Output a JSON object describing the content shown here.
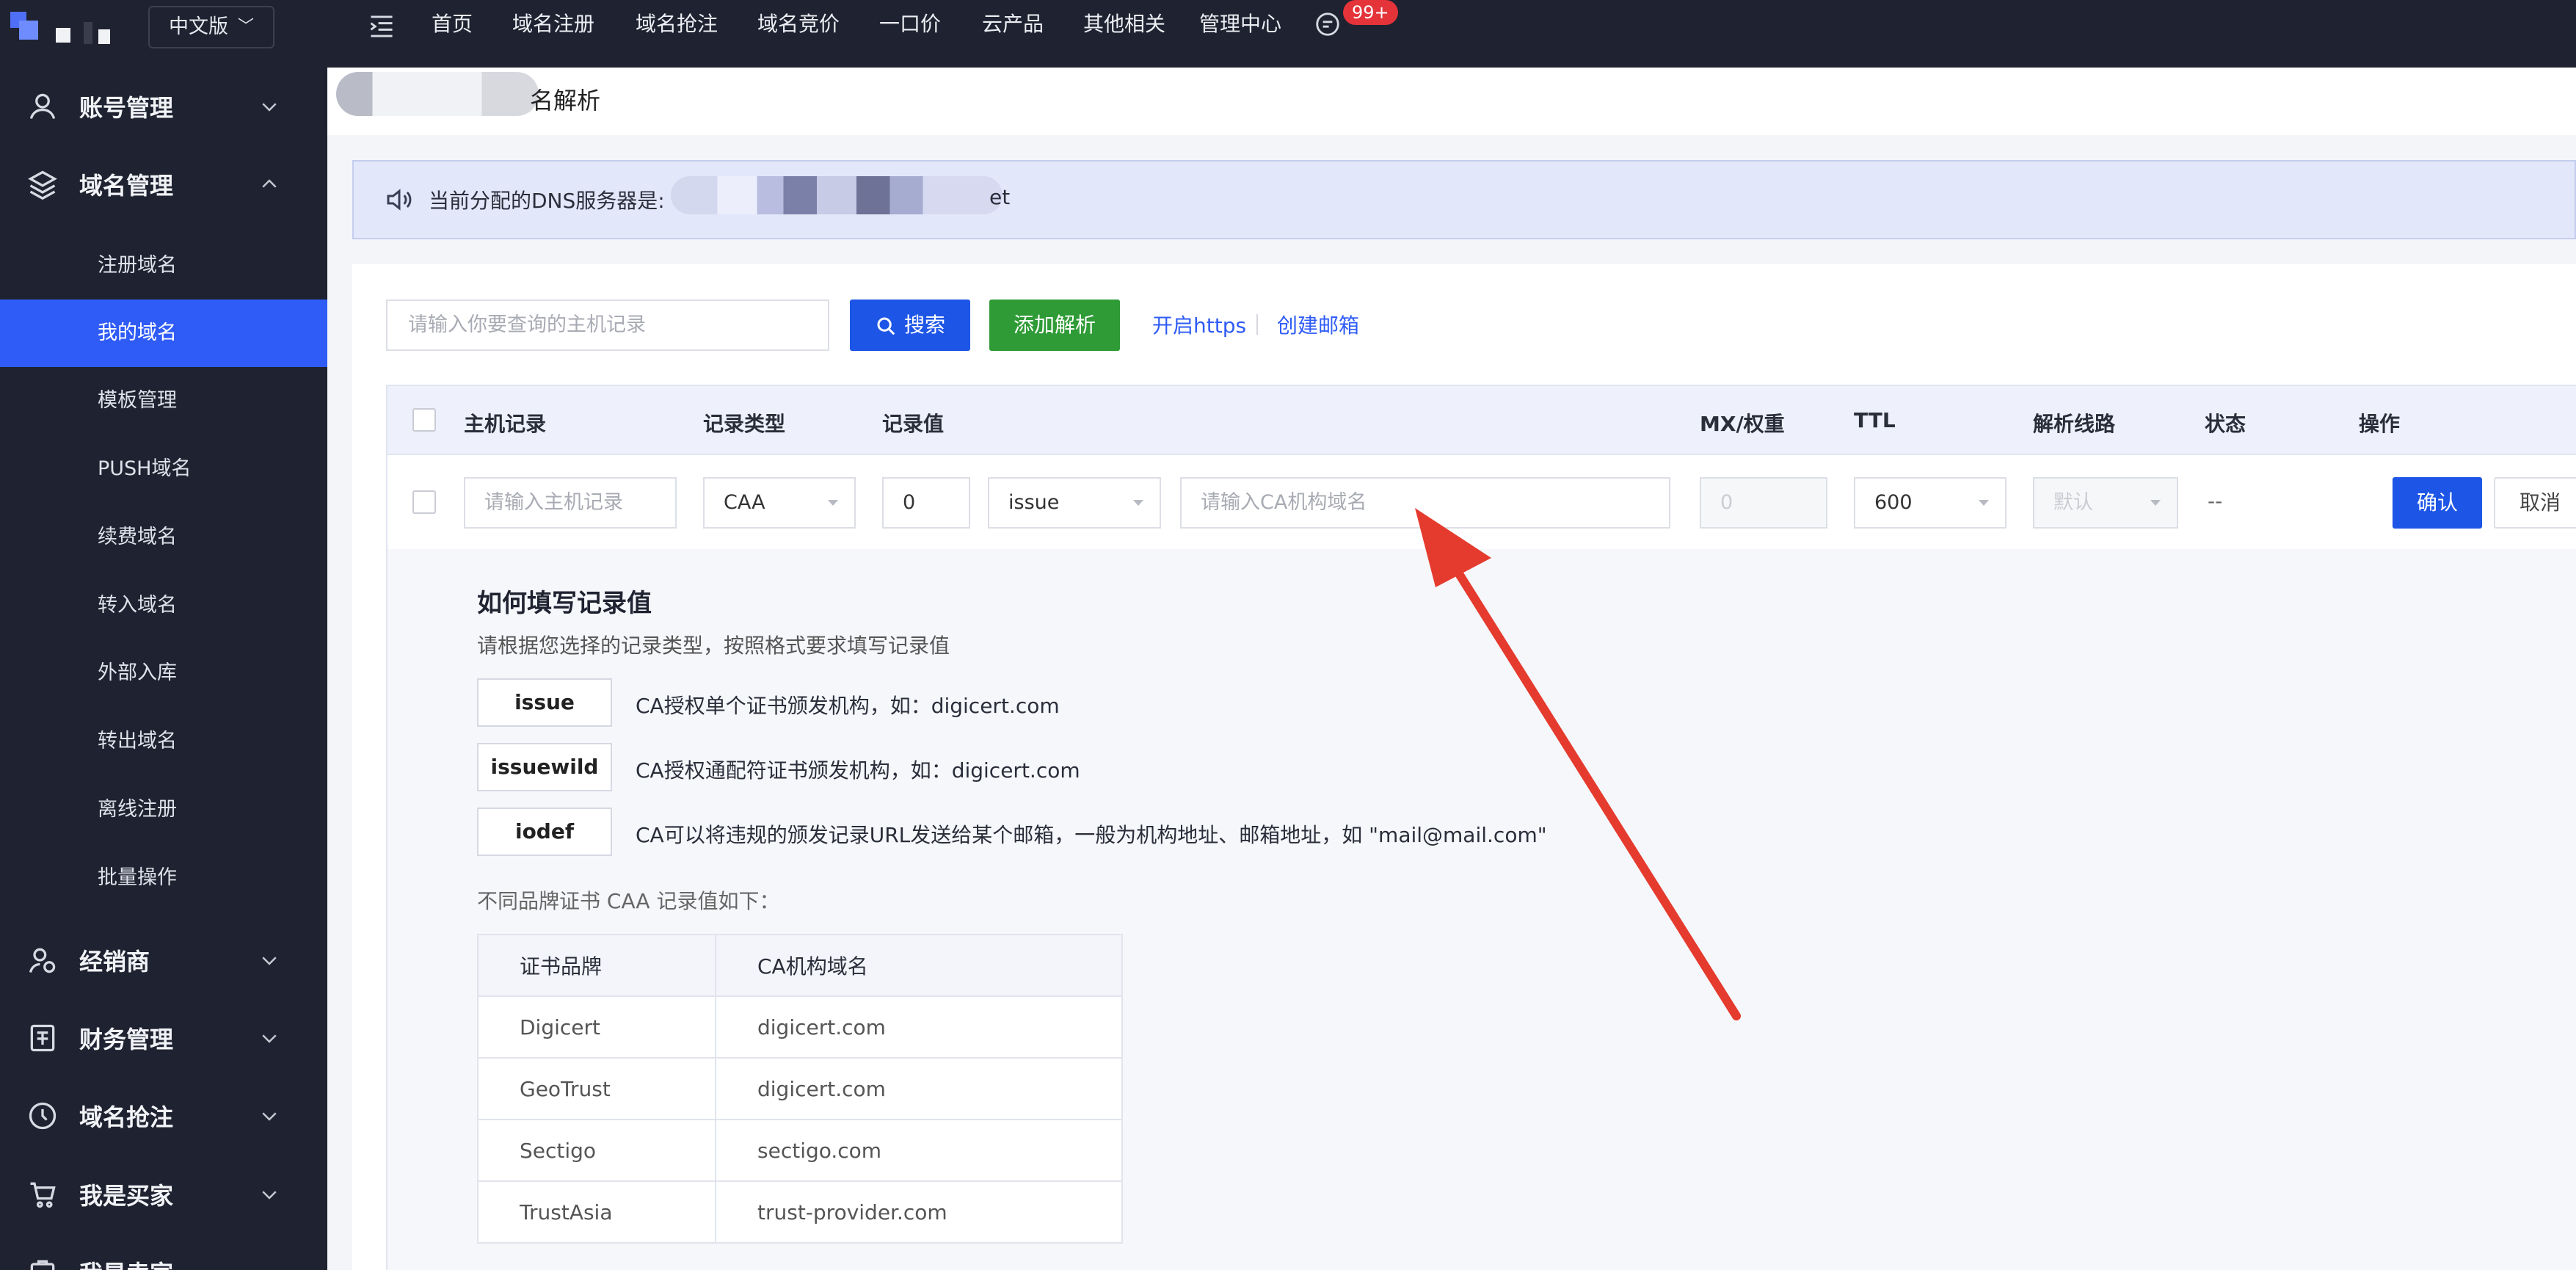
{
  "sidebar": {
    "language": "中文版",
    "groups_top": [
      {
        "label": "账号管理",
        "icon": "user-icon"
      },
      {
        "label": "域名管理",
        "icon": "layers-icon"
      }
    ],
    "domain_items": [
      {
        "label": "注册域名"
      },
      {
        "label": "我的域名"
      },
      {
        "label": "模板管理"
      },
      {
        "label": "PUSH域名"
      },
      {
        "label": "续费域名"
      },
      {
        "label": "转入域名"
      },
      {
        "label": "外部入库"
      },
      {
        "label": "转出域名"
      },
      {
        "label": "离线注册"
      },
      {
        "label": "批量操作"
      }
    ],
    "groups_bottom": [
      {
        "label": "经销商",
        "icon": "agent-icon"
      },
      {
        "label": "财务管理",
        "icon": "finance-icon"
      },
      {
        "label": "域名抢注",
        "icon": "clock-icon"
      },
      {
        "label": "我是买家",
        "icon": "cart-icon"
      },
      {
        "label": "我是卖家",
        "icon": "seller-icon"
      }
    ]
  },
  "topnav": {
    "items": [
      "首页",
      "域名注册",
      "域名抢注",
      "域名竞价",
      "一口价",
      "云产品",
      "其他相关",
      "管理中心"
    ],
    "badge": "99+"
  },
  "page": {
    "title_suffix": "名解析"
  },
  "notice": {
    "text": "当前分配的DNS服务器是:",
    "suffix": "et"
  },
  "toolbar": {
    "search_placeholder": "请输入你要查询的主机记录",
    "search_label": "搜索",
    "add_label": "添加解析",
    "https_link": "开启https",
    "mail_link": "创建邮箱"
  },
  "table": {
    "headers": [
      "主机记录",
      "记录类型",
      "记录值",
      "MX/权重",
      "TTL",
      "解析线路",
      "状态",
      "操作"
    ]
  },
  "edit_row": {
    "host_placeholder": "请输入主机记录",
    "record_type": "CAA",
    "flag": "0",
    "tag": "issue",
    "value_placeholder": "请输入CA机构域名",
    "mx_placeholder": "0",
    "ttl": "600",
    "line_placeholder": "默认",
    "status": "--",
    "confirm_label": "确认",
    "cancel_label": "取消"
  },
  "help": {
    "title": "如何填写记录值",
    "subtitle": "请根据您选择的记录类型，按照格式要求填写记录值",
    "tags": [
      {
        "tag": "issue",
        "desc": "CA授权单个证书颁发机构，如：digicert.com"
      },
      {
        "tag": "issuewild",
        "desc": "CA授权通配符证书颁发机构，如：digicert.com"
      },
      {
        "tag": "iodef",
        "desc": "CA可以将违规的颁发记录URL发送给某个邮箱，一般为机构地址、邮箱地址，如 \"mail@mail.com\""
      }
    ],
    "brand_intro": "不同品牌证书 CAA 记录值如下：",
    "brand_headers": [
      "证书品牌",
      "CA机构域名"
    ],
    "brands": [
      [
        "Digicert",
        "digicert.com"
      ],
      [
        "GeoTrust",
        "digicert.com"
      ],
      [
        "Sectigo",
        "sectigo.com"
      ],
      [
        "TrustAsia",
        "trust-provider.com"
      ]
    ]
  },
  "colors": {
    "sidebar_bg": "#1f2230",
    "active_blue": "#2f5cf6",
    "primary_button": "#1d55e6",
    "add_button": "#2f9b36",
    "badge_red": "#e5333a",
    "annotation_arrow": "#e53b2e"
  }
}
